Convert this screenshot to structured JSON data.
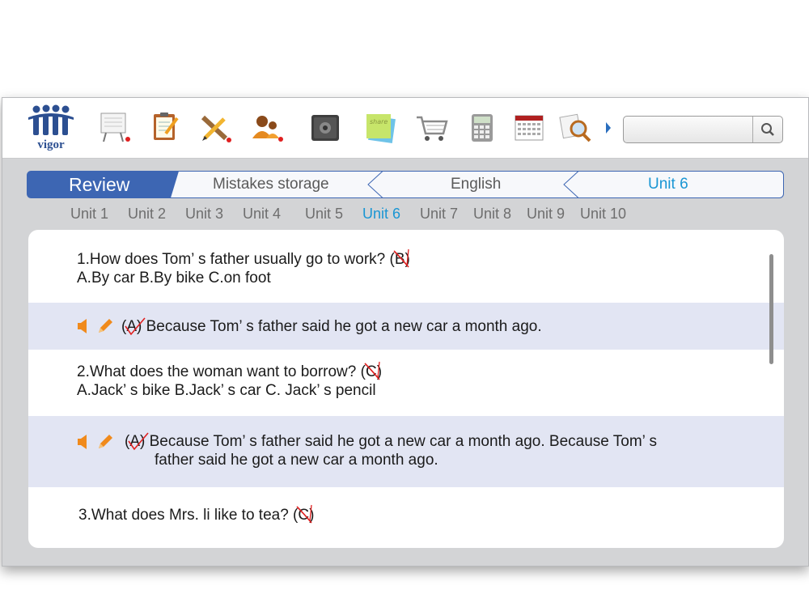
{
  "logo": {
    "text": "vigor"
  },
  "toolbar": {
    "tools": [
      "presentation-icon",
      "notepad-icon",
      "pencil-ruler-icon",
      "users-icon",
      "safe-icon",
      "sticky-notes-icon",
      "shopping-cart-icon",
      "calculator-icon",
      "calendar-icon",
      "magnifier-documents-icon"
    ],
    "share_label": "share"
  },
  "search": {
    "value": "",
    "placeholder": ""
  },
  "breadcrumb": {
    "review": "Review",
    "item1": "Mistakes storage",
    "item2": "English",
    "item3": "Unit 6"
  },
  "units": [
    "Unit 1",
    "Unit 2",
    "Unit 3",
    "Unit 4",
    "Unit 5",
    "Unit 6",
    "Unit 7",
    "Unit 8",
    "Unit 9",
    "Unit 10"
  ],
  "active_unit": "Unit 6",
  "questions": [
    {
      "q": "1.How does Tom’ s father usually go to work? (",
      "mark": "B",
      "q_end": ")",
      "options": "A.By car    B.By bike   C.on foot",
      "answer_mark": "A",
      "answer": " Because Tom’ s father said he got a new car a month ago."
    },
    {
      "q": "2.What does the woman want to borrow? (",
      "mark": "C",
      "q_end": ")",
      "options": "A.Jack’ s bike   B.Jack’ s car  C. Jack’ s pencil",
      "answer_mark": "A",
      "answer": " Because Tom’ s father said he got a new car a month ago.  Because Tom’ s",
      "answer_line2": "father said he got a new car a month ago."
    },
    {
      "q": "3.What does Mrs. li like to tea? (",
      "mark": "C",
      "q_end": ")"
    }
  ],
  "colors": {
    "brand": "#2c4f91",
    "accent": "#1a96d4",
    "review_bg": "#3d66b3",
    "alt_row": "#e2e5f3",
    "mark_red": "#e02020",
    "speaker": "#f08a1c"
  }
}
